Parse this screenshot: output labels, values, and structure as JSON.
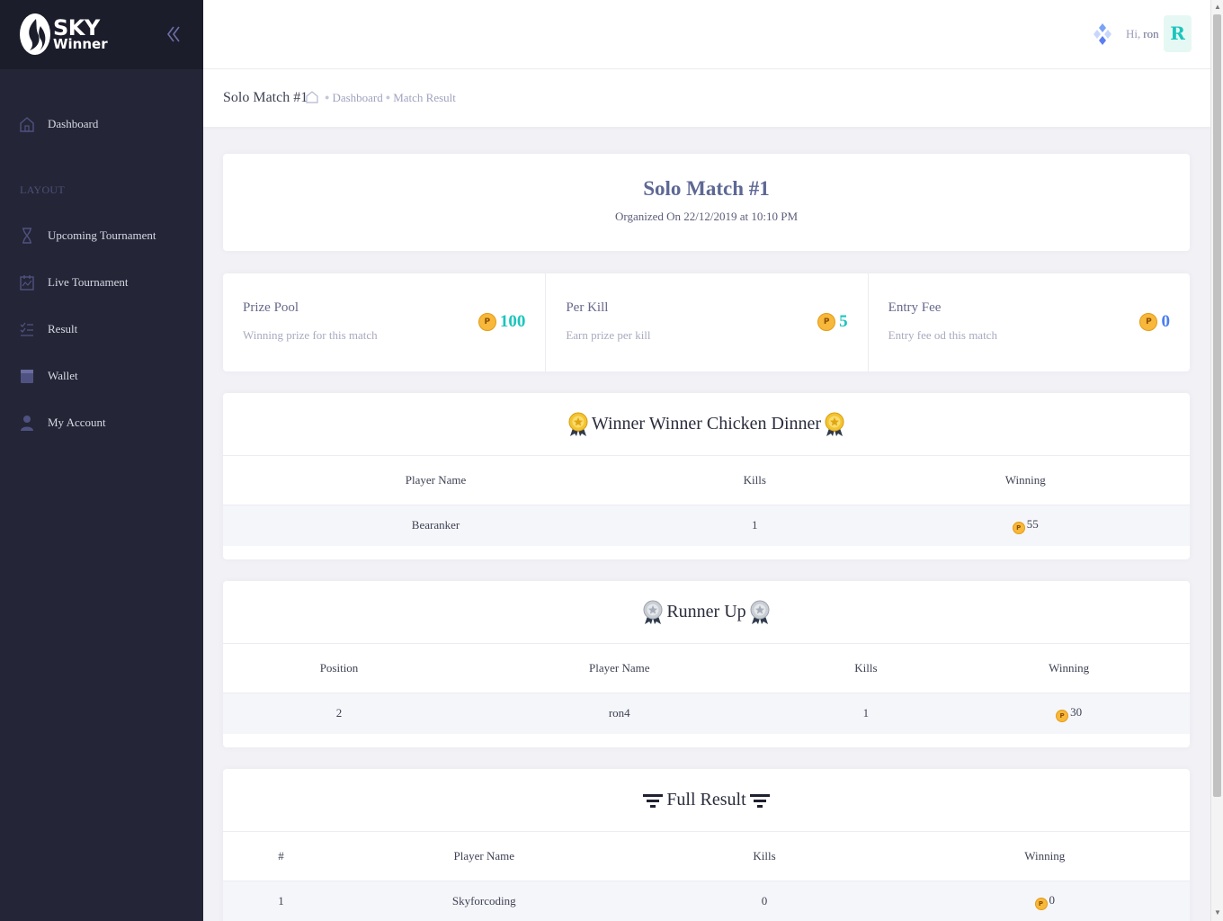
{
  "brand": {
    "line1": "SKY",
    "line2": "Winner"
  },
  "sidebar": {
    "dashboard": "Dashboard",
    "section_label": "LAYOUT",
    "items": [
      {
        "label": "Upcoming Tournament",
        "icon": "hourglass-icon"
      },
      {
        "label": "Live Tournament",
        "icon": "calendar-chart-icon"
      },
      {
        "label": "Result",
        "icon": "list-check-icon"
      },
      {
        "label": "Wallet",
        "icon": "wallet-icon"
      },
      {
        "label": "My Account",
        "icon": "user-icon"
      }
    ]
  },
  "header": {
    "greeting": "Hi,",
    "username": "ron",
    "avatar_letter": "R"
  },
  "subheader": {
    "title": "Solo Match #1",
    "crumb1": "Dashboard",
    "crumb2": "Match Result"
  },
  "match": {
    "title": "Solo Match #1",
    "organized": "Organized On 22/12/2019 at 10:10 PM"
  },
  "stats": [
    {
      "title": "Prize Pool",
      "sub": "Winning prize for this match",
      "value": "100",
      "color": "#1bc5bd"
    },
    {
      "title": "Per Kill",
      "sub": "Earn prize per kill",
      "value": "5",
      "color": "#1bc5bd"
    },
    {
      "title": "Entry Fee",
      "sub": "Entry fee od this match",
      "value": "0",
      "color": "#4a7ef0"
    }
  ],
  "coin_symbol": "P",
  "winner": {
    "heading": "Winner Winner Chicken Dinner",
    "columns": [
      "Player Name",
      "Kills",
      "Winning"
    ],
    "row": {
      "player": "Bearanker",
      "kills": "1",
      "winning": "55"
    }
  },
  "runner_up": {
    "heading": "Runner Up",
    "columns": [
      "Position",
      "Player Name",
      "Kills",
      "Winning"
    ],
    "row": {
      "position": "2",
      "player": "ron4",
      "kills": "1",
      "winning": "30"
    }
  },
  "full_result": {
    "heading": "Full Result",
    "columns": [
      "#",
      "Player Name",
      "Kills",
      "Winning"
    ],
    "row": {
      "index": "1",
      "player": "Skyforcoding",
      "kills": "0",
      "winning": "0"
    }
  }
}
